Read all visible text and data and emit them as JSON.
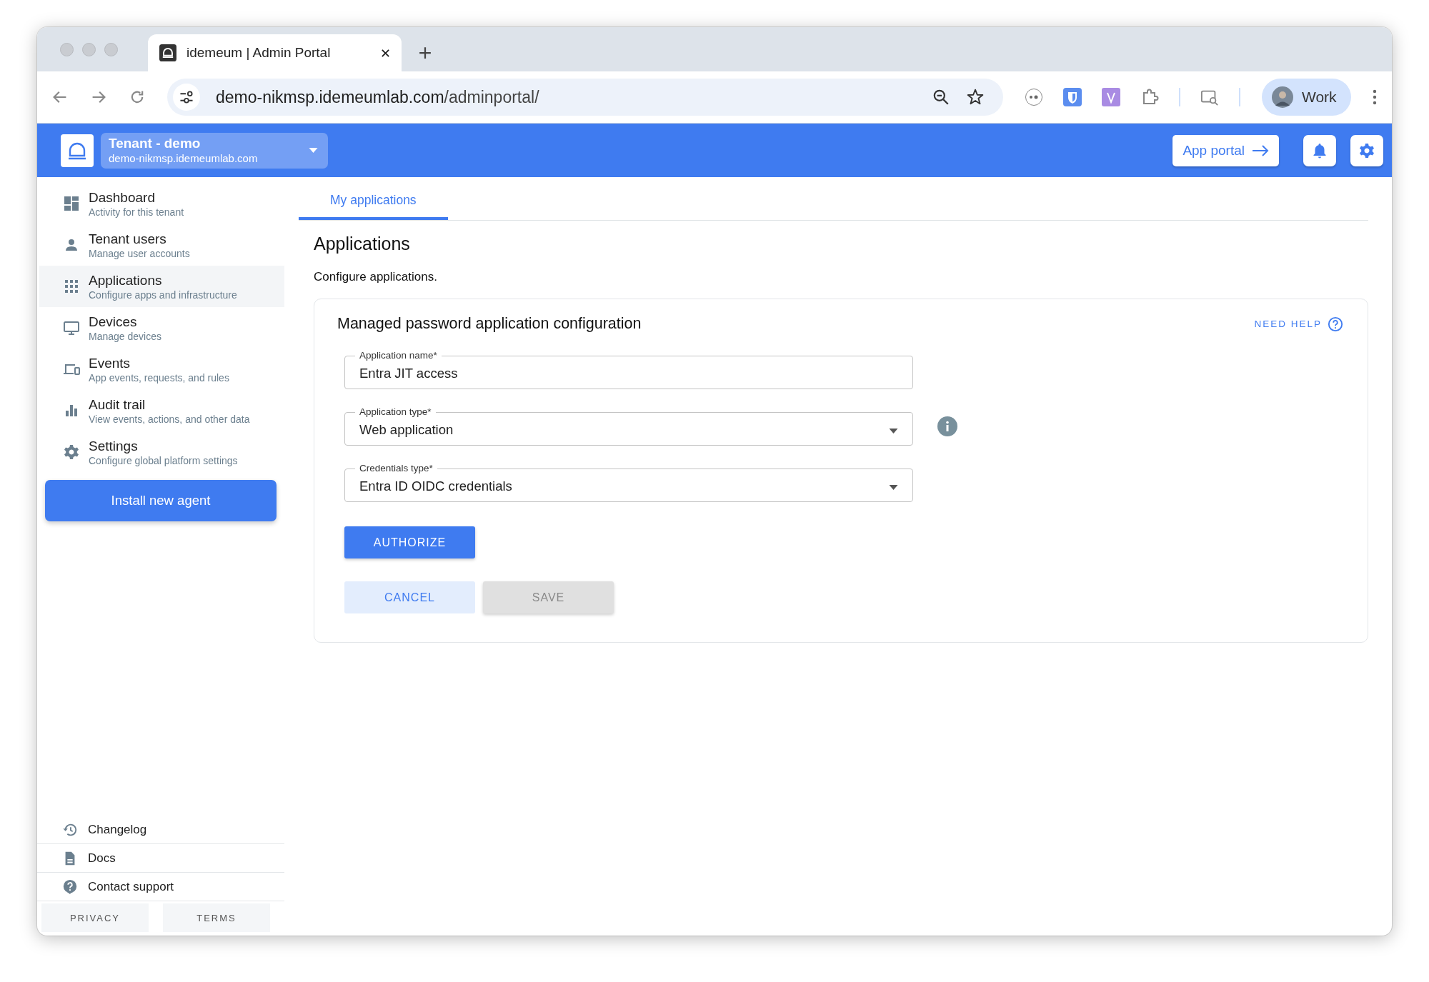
{
  "browser": {
    "tab_title": "idemeum | Admin Portal",
    "url_host": "demo-nikmsp.idemeumlab.com",
    "url_path": "/adminportal/",
    "profile_label": "Work"
  },
  "header": {
    "tenant_name": "Tenant - demo",
    "tenant_domain": "demo-nikmsp.idemeumlab.com",
    "app_portal_label": "App portal"
  },
  "sidebar": {
    "items": [
      {
        "label": "Dashboard",
        "description": "Activity for this tenant",
        "selected": false
      },
      {
        "label": "Tenant users",
        "description": "Manage user accounts",
        "selected": false
      },
      {
        "label": "Applications",
        "description": "Configure apps and infrastructure",
        "selected": true
      },
      {
        "label": "Devices",
        "description": "Manage devices",
        "selected": false
      },
      {
        "label": "Events",
        "description": "App events, requests, and rules",
        "selected": false
      },
      {
        "label": "Audit trail",
        "description": "View events, actions, and other data",
        "selected": false
      },
      {
        "label": "Settings",
        "description": "Configure global platform settings",
        "selected": false
      }
    ],
    "install_button": "Install new agent",
    "footer_links": [
      "Changelog",
      "Docs",
      "Contact support"
    ],
    "legal_links": [
      "PRIVACY",
      "TERMS"
    ]
  },
  "main": {
    "tabs": [
      {
        "label": "My applications",
        "selected": true
      }
    ],
    "heading": "Applications",
    "subtitle": "Configure applications.",
    "card": {
      "title": "Managed password application configuration",
      "help_label": "NEED HELP",
      "fields": [
        {
          "kind": "text",
          "label": "Application name*",
          "value": "Entra JIT access",
          "info": false
        },
        {
          "kind": "select",
          "label": "Application type*",
          "value": "Web application",
          "info": true
        },
        {
          "kind": "select",
          "label": "Credentials type*",
          "value": "Entra ID OIDC credentials",
          "info": false
        }
      ],
      "authorize_label": "AUTHORIZE",
      "actions": [
        {
          "kind": "secondary",
          "label": "CANCEL",
          "disabled": false
        },
        {
          "kind": "primary",
          "label": "SAVE",
          "disabled": true
        }
      ]
    }
  }
}
